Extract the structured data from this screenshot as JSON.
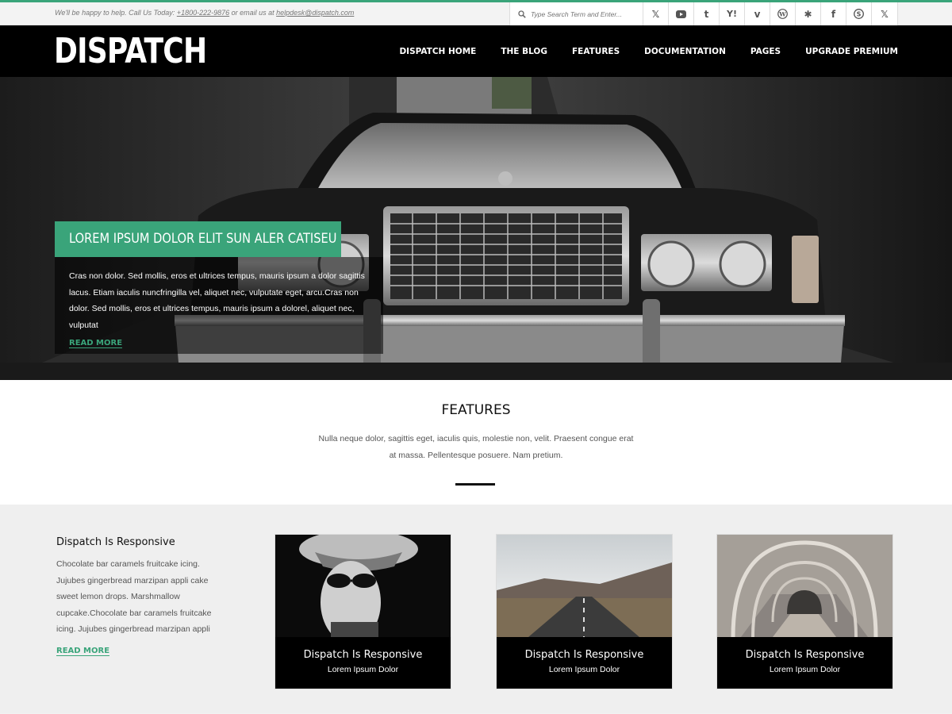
{
  "topbar": {
    "help_text": "We'll be happy to help. Call Us Today: ",
    "phone": "+1800-222-9876",
    "or_text": " or email us at ",
    "email": "helpdesk@dispatch.com",
    "search_placeholder": "Type Search Term and Enter...",
    "social_icons": [
      "twitter-icon",
      "youtube-icon",
      "tumblr-icon",
      "yahoo-icon",
      "vimeo-icon",
      "wordpress-icon",
      "yelp-icon",
      "facebook-icon",
      "skype-icon",
      "twitter-icon"
    ]
  },
  "header": {
    "logo": "DISPATCH",
    "nav": [
      "DISPATCH HOME",
      "THE BLOG",
      "FEATURES",
      "DOCUMENTATION",
      "PAGES",
      "UPGRADE PREMIUM"
    ]
  },
  "hero": {
    "title": "LOREM IPSUM DOLOR ELIT SUN ALER CATISEU",
    "body": "Cras non dolor. Sed mollis, eros et ultrices tempus, mauris ipsum a dolor sagittis lacus. Etiam iaculis nuncfringilla vel, aliquet nec, vulputate eget, arcu.Cras non dolor. Sed mollis, eros et ultrices tempus, mauris ipsum a dolorel, aliquet nec, vulputat",
    "read_more": "READ MORE"
  },
  "features": {
    "title": "FEATURES",
    "text": "Nulla neque dolor, sagittis eget, iaculis quis, molestie non, velit. Praesent congue erat at massa. Pellentesque posuere. Nam pretium."
  },
  "sidebar": {
    "title": "Dispatch Is Responsive",
    "text": "Chocolate bar caramels fruitcake icing. Jujubes gingerbread marzipan appli cake sweet lemon drops. Marshmallow cupcake.Chocolate bar caramels fruitcake icing. Jujubes gingerbread marzipan appli",
    "read_more": "READ MORE"
  },
  "cards": [
    {
      "title": "Dispatch Is Responsive",
      "subtitle": "Lorem Ipsum Dolor"
    },
    {
      "title": "Dispatch Is Responsive",
      "subtitle": "Lorem Ipsum Dolor"
    },
    {
      "title": "Dispatch Is Responsive",
      "subtitle": "Lorem Ipsum Dolor"
    }
  ],
  "colors": {
    "accent": "#3aa47a",
    "header_bg": "#000000"
  }
}
